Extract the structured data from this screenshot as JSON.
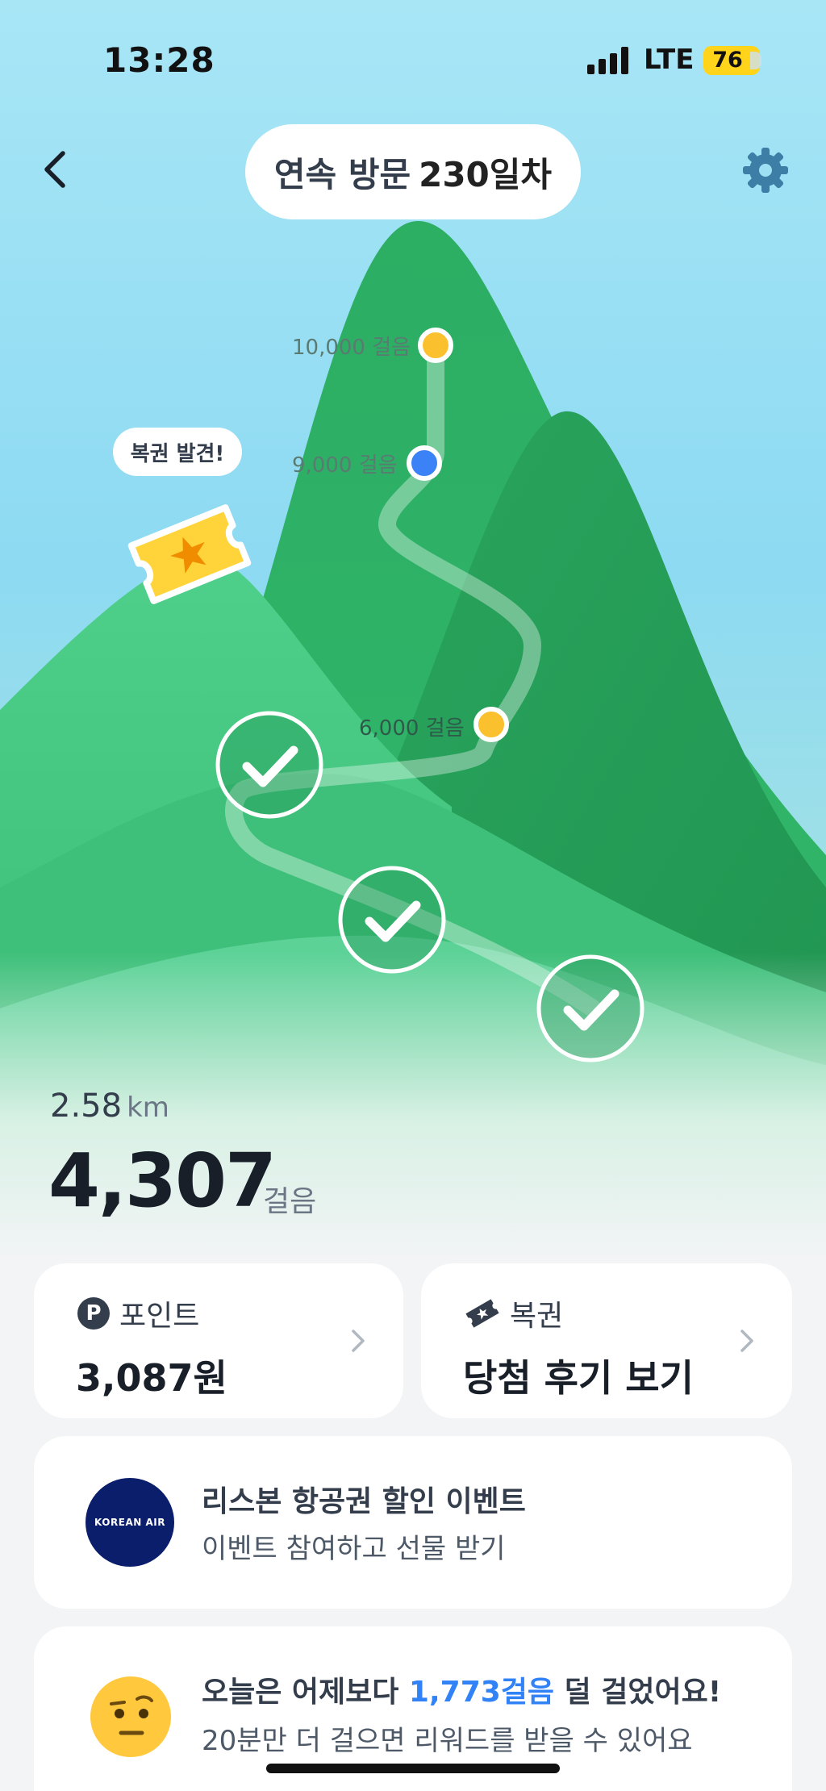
{
  "status_bar": {
    "time": "13:28",
    "network": "LTE",
    "battery": "76"
  },
  "header": {
    "back_icon": "chevron-left-icon",
    "visit_label": "연속 방문",
    "visit_days": "230일차",
    "settings_icon": "gear-icon"
  },
  "map": {
    "milestones": [
      {
        "label": "10,000 걸음",
        "state": "upcoming"
      },
      {
        "label": "9,000 걸음",
        "state": "current"
      },
      {
        "label": "6,000 걸음",
        "state": "upcoming"
      }
    ],
    "completed_checkpoints": 3,
    "lottery_bubble": "복권 발견!",
    "ticket_icon": "lottery-ticket-star-icon"
  },
  "stats": {
    "distance_value": "2.58",
    "distance_unit": "km",
    "steps_value": "4,307",
    "steps_unit": "걸음"
  },
  "cards": {
    "point": {
      "icon": "p-point-icon",
      "icon_char": "P",
      "title": "포인트",
      "value": "3,087원"
    },
    "lottery": {
      "icon": "ticket-icon",
      "title": "복권",
      "value": "당첨 후기 보기"
    }
  },
  "event": {
    "logo_text": "KOREAN AIR",
    "title": "리스본 항공권 할인 이벤트",
    "subtitle": "이벤트 참여하고 선물 받기"
  },
  "message": {
    "emoji": "skeptical-face-icon",
    "line1_prefix": "오늘은 어제보다 ",
    "line1_highlight": "1,773걸음",
    "line1_suffix": " 덜 걸었어요!",
    "line2": "20분만 더 걸으면 리워드를 받을 수 있어요"
  },
  "colors": {
    "sky_top": "#9ee3f5",
    "mountain": "#2fb36a",
    "highlight": "#3182f6",
    "milestone_yellow": "#fbc02d",
    "milestone_blue": "#3b82f6"
  }
}
